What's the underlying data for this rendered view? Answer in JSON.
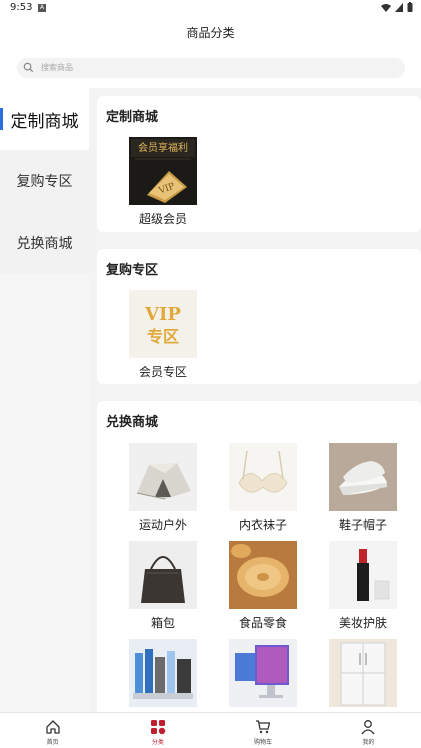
{
  "status": {
    "time": "9:53",
    "notif": "A"
  },
  "header": {
    "title": "商品分类"
  },
  "search": {
    "placeholder": "搜索商品"
  },
  "sidebar": {
    "items": [
      {
        "label": "定制商城",
        "active": true
      },
      {
        "label": "复购专区",
        "active": false
      },
      {
        "label": "兑换商城",
        "active": false
      }
    ]
  },
  "sections": {
    "custom": {
      "title": "定制商城",
      "items": [
        {
          "label": "超级会员",
          "icon": "vip-card-image"
        }
      ]
    },
    "repurchase": {
      "title": "复购专区",
      "items": [
        {
          "label": "会员专区",
          "icon": "vip-zone-image"
        }
      ]
    },
    "exchange": {
      "title": "兑换商城",
      "items": [
        {
          "label": "运动户外",
          "icon": "tent-image"
        },
        {
          "label": "内衣袜子",
          "icon": "bra-image"
        },
        {
          "label": "鞋子帽子",
          "icon": "sneakers-image"
        },
        {
          "label": "箱包",
          "icon": "handbag-image"
        },
        {
          "label": "食品零食",
          "icon": "cookies-image"
        },
        {
          "label": "美妆护肤",
          "icon": "lipstick-image"
        },
        {
          "label": "",
          "icon": "stationery-image"
        },
        {
          "label": "",
          "icon": "monitor-image"
        },
        {
          "label": "",
          "icon": "refrigerator-image"
        }
      ]
    }
  },
  "vip_card_text": {
    "line1": "会员享福利",
    "line2": "VIP"
  },
  "vip_zone_text": {
    "line1": "VIP",
    "line2": "专区"
  },
  "tabbar": {
    "items": [
      {
        "label": "首页",
        "icon": "home-icon"
      },
      {
        "label": "分类",
        "icon": "category-icon"
      },
      {
        "label": "购物车",
        "icon": "cart-icon"
      },
      {
        "label": "我的",
        "icon": "profile-icon"
      }
    ]
  },
  "colors": {
    "accent": "#c01f2f",
    "nav_indicator": "#2e6de0",
    "gold": "#d8a640"
  }
}
